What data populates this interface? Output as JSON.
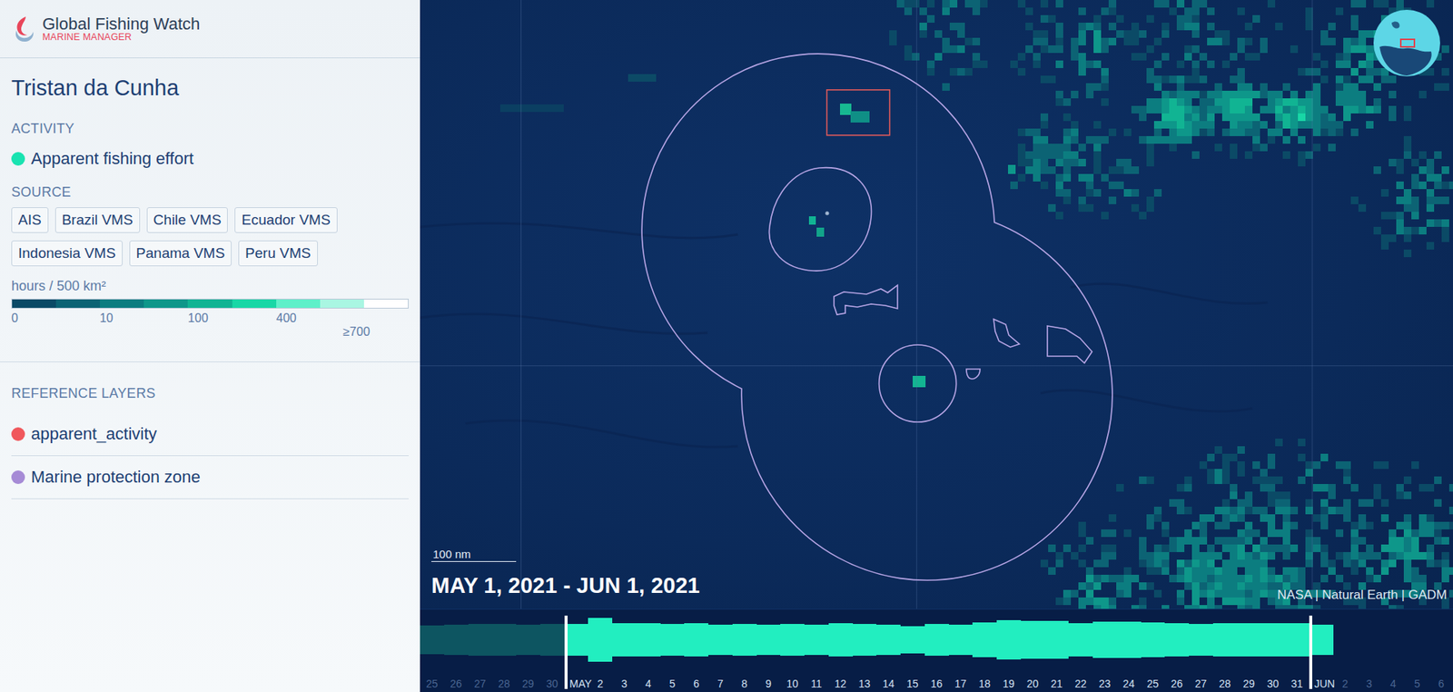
{
  "app": {
    "title": "Global Fishing Watch",
    "subtitle": "MARINE MANAGER"
  },
  "sidebar": {
    "title": "Tristan da Cunha",
    "activity": {
      "heading": "ACTIVITY",
      "layers": [
        {
          "label": "Apparent fishing effort",
          "color": "#19e3b1"
        }
      ]
    },
    "source": {
      "heading": "SOURCE",
      "tags": [
        "AIS",
        "Brazil VMS",
        "Chile VMS",
        "Ecuador VMS",
        "Indonesia VMS",
        "Panama VMS",
        "Peru VMS"
      ]
    },
    "legend": {
      "unit": "hours / 500 km²",
      "colors": [
        "#0b4a66",
        "#0c6374",
        "#0c7d80",
        "#0e978a",
        "#11b493",
        "#18d7a6",
        "#5ef0c9",
        "#a9f6e2",
        "#ffffff"
      ],
      "ticks": [
        "0",
        "10",
        "100",
        "400",
        "≥700"
      ]
    },
    "reference": {
      "heading": "REFERENCE LAYERS",
      "layers": [
        {
          "label": "apparent_activity",
          "color": "#f0585c"
        },
        {
          "label": "Marine protection zone",
          "color": "#a68bd6"
        }
      ]
    }
  },
  "map": {
    "scale": "100 nm",
    "date_range": "MAY 1, 2021 - JUN 1, 2021",
    "attribution": "NASA | Natural Earth | GADM"
  },
  "timeline": {
    "days": [
      {
        "label": "25",
        "value": 0.55,
        "in_range": false,
        "handle": false
      },
      {
        "label": "26",
        "value": 0.58,
        "in_range": false,
        "handle": false
      },
      {
        "label": "27",
        "value": 0.6,
        "in_range": false,
        "handle": false
      },
      {
        "label": "28",
        "value": 0.6,
        "in_range": false,
        "handle": false
      },
      {
        "label": "29",
        "value": 0.58,
        "in_range": false,
        "handle": false
      },
      {
        "label": "30",
        "value": 0.6,
        "in_range": false,
        "handle": false
      },
      {
        "label": "MAY",
        "value": 0.6,
        "in_range": true,
        "handle": true
      },
      {
        "label": "2",
        "value": 0.82,
        "in_range": true,
        "handle": false
      },
      {
        "label": "3",
        "value": 0.62,
        "in_range": true,
        "handle": false
      },
      {
        "label": "4",
        "value": 0.62,
        "in_range": true,
        "handle": false
      },
      {
        "label": "5",
        "value": 0.6,
        "in_range": true,
        "handle": false
      },
      {
        "label": "6",
        "value": 0.62,
        "in_range": true,
        "handle": false
      },
      {
        "label": "7",
        "value": 0.58,
        "in_range": true,
        "handle": false
      },
      {
        "label": "8",
        "value": 0.6,
        "in_range": true,
        "handle": false
      },
      {
        "label": "9",
        "value": 0.58,
        "in_range": true,
        "handle": false
      },
      {
        "label": "10",
        "value": 0.6,
        "in_range": true,
        "handle": false
      },
      {
        "label": "11",
        "value": 0.58,
        "in_range": true,
        "handle": false
      },
      {
        "label": "12",
        "value": 0.62,
        "in_range": true,
        "handle": false
      },
      {
        "label": "13",
        "value": 0.6,
        "in_range": true,
        "handle": false
      },
      {
        "label": "14",
        "value": 0.56,
        "in_range": true,
        "handle": false
      },
      {
        "label": "15",
        "value": 0.52,
        "in_range": true,
        "handle": false
      },
      {
        "label": "16",
        "value": 0.6,
        "in_range": true,
        "handle": false
      },
      {
        "label": "17",
        "value": 0.58,
        "in_range": true,
        "handle": false
      },
      {
        "label": "18",
        "value": 0.66,
        "in_range": true,
        "handle": false
      },
      {
        "label": "19",
        "value": 0.74,
        "in_range": true,
        "handle": false
      },
      {
        "label": "20",
        "value": 0.72,
        "in_range": true,
        "handle": false
      },
      {
        "label": "21",
        "value": 0.72,
        "in_range": true,
        "handle": false
      },
      {
        "label": "22",
        "value": 0.64,
        "in_range": true,
        "handle": false
      },
      {
        "label": "23",
        "value": 0.68,
        "in_range": true,
        "handle": false
      },
      {
        "label": "24",
        "value": 0.68,
        "in_range": true,
        "handle": false
      },
      {
        "label": "25",
        "value": 0.66,
        "in_range": true,
        "handle": false
      },
      {
        "label": "26",
        "value": 0.62,
        "in_range": true,
        "handle": false
      },
      {
        "label": "27",
        "value": 0.6,
        "in_range": true,
        "handle": false
      },
      {
        "label": "28",
        "value": 0.62,
        "in_range": true,
        "handle": false
      },
      {
        "label": "29",
        "value": 0.64,
        "in_range": true,
        "handle": false
      },
      {
        "label": "30",
        "value": 0.64,
        "in_range": true,
        "handle": false
      },
      {
        "label": "31",
        "value": 0.62,
        "in_range": true,
        "handle": false
      },
      {
        "label": "JUN",
        "value": 0.58,
        "in_range": true,
        "handle": true
      },
      {
        "label": "2",
        "value": 0,
        "in_range": false,
        "handle": false
      },
      {
        "label": "3",
        "value": 0,
        "in_range": false,
        "handle": false
      },
      {
        "label": "4",
        "value": 0,
        "in_range": false,
        "handle": false
      },
      {
        "label": "5",
        "value": 0,
        "in_range": false,
        "handle": false
      },
      {
        "label": "6",
        "value": 0,
        "in_range": false,
        "handle": false
      }
    ]
  }
}
